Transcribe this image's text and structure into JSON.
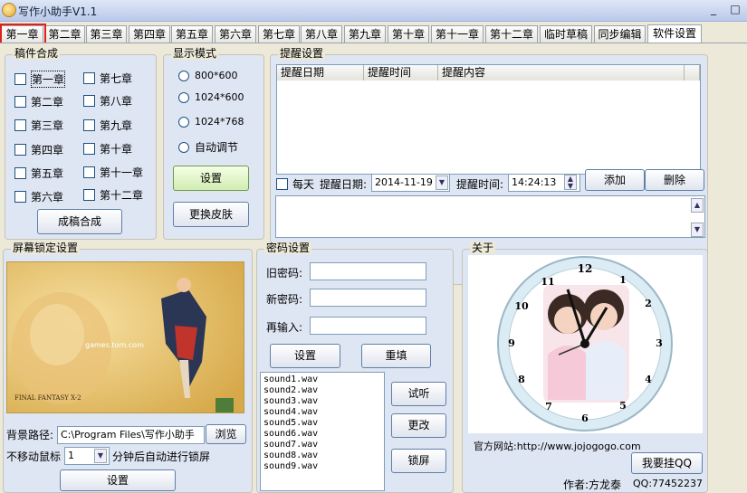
{
  "window": {
    "title": "写作小助手V1.1",
    "minimize": "_",
    "maximize": "□"
  },
  "tabs": [
    "第一章",
    "第二章",
    "第三章",
    "第四章",
    "第五章",
    "第六章",
    "第七章",
    "第八章",
    "第九章",
    "第十章",
    "第十一章",
    "第十二章",
    "临时草稿",
    "同步编辑",
    "软件设置"
  ],
  "active_tab": "软件设置",
  "merge": {
    "legend": "稿件合成",
    "left": [
      "第一章",
      "第二章",
      "第三章",
      "第四章",
      "第五章",
      "第六章"
    ],
    "right": [
      "第七章",
      "第八章",
      "第九章",
      "第十章",
      "第十一章",
      "第十二章"
    ],
    "button": "成稿合成"
  },
  "display": {
    "legend": "显示模式",
    "options": [
      "800*600",
      "1024*600",
      "1024*768",
      "自动调节"
    ],
    "set_button": "设置",
    "skin_button": "更换皮肤"
  },
  "reminder": {
    "legend": "提醒设置",
    "columns": [
      "提醒日期",
      "提醒时间",
      "提醒内容"
    ],
    "everyday": "每天",
    "date_label": "提醒日期:",
    "date_value": "2014-11-19",
    "time_label": "提醒时间:",
    "time_value": "14:24:13",
    "add_button": "添加",
    "delete_button": "删除"
  },
  "lock": {
    "legend": "屏幕锁定设置",
    "watermark": "games.tom.com",
    "game_title": "FINAL FANTASY X-2",
    "path_label": "背景路径:",
    "path_value": "C:\\Program Files\\写作小助手",
    "browse_button": "浏览",
    "idle_label": "不移动鼠标",
    "idle_value": "1",
    "idle_suffix": "分钟后自动进行锁屏",
    "set_button": "设置"
  },
  "password": {
    "legend": "密码设置",
    "old_label": "旧密码:",
    "new_label": "新密码:",
    "repeat_label": "再输入:",
    "set_button": "设置",
    "reset_button": "重填",
    "sounds": [
      "sound1.wav",
      "sound2.wav",
      "sound3.wav",
      "sound4.wav",
      "sound5.wav",
      "sound6.wav",
      "sound7.wav",
      "sound8.wav",
      "sound9.wav"
    ],
    "listen_button": "试听",
    "change_button": "更改",
    "lock_button": "锁屏"
  },
  "about": {
    "legend": "关于",
    "website": "官方网站:http://www.jojogogo.com",
    "qq_button": "我要挂QQ",
    "author": "作者:方龙泰",
    "qq": "QQ:77452237",
    "clock_numbers": [
      "12",
      "1",
      "2",
      "3",
      "4",
      "5",
      "6",
      "7",
      "8",
      "9",
      "10",
      "11"
    ]
  },
  "colors": {
    "accent_red": "#e0211b",
    "panel_bg": "#dfe6f3",
    "button_green": "#d2ecb2"
  }
}
